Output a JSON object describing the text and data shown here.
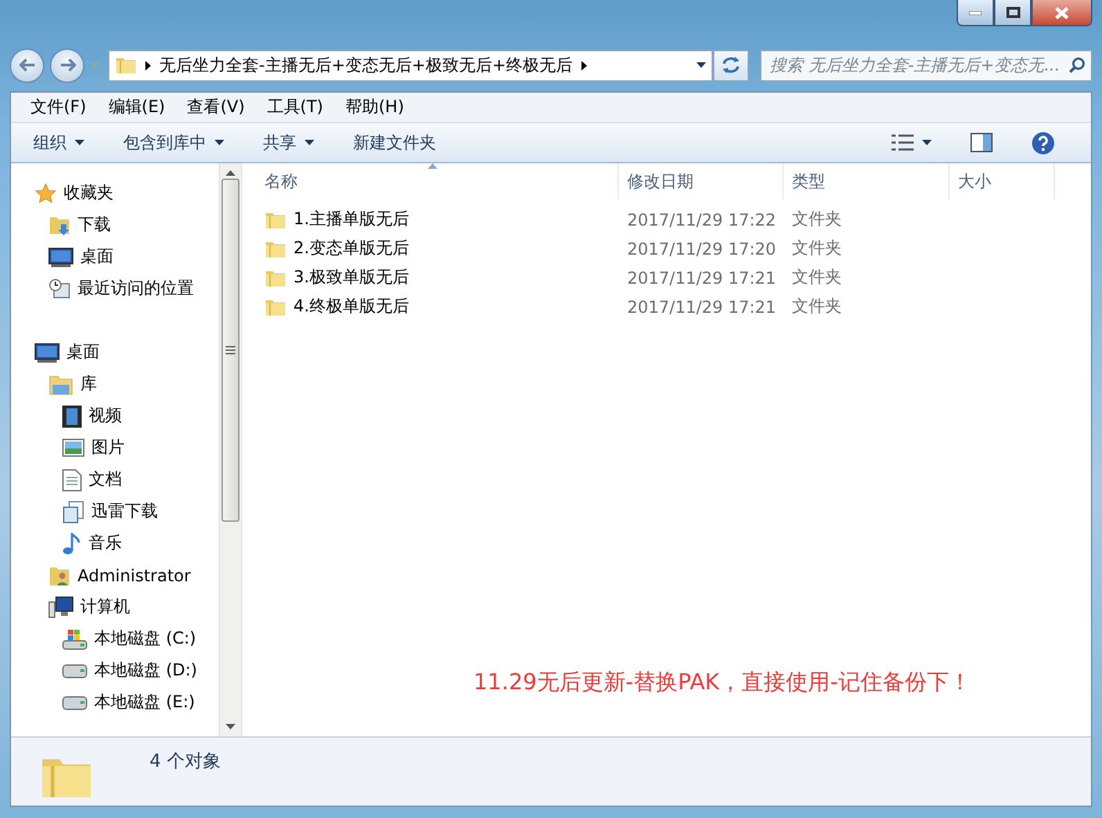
{
  "address": {
    "path": "无后坐力全套-主播无后+变态无后+极致无后+终极无后",
    "search_placeholder": "搜索 无后坐力全套-主播无后+变态无..."
  },
  "menu": [
    "文件(F)",
    "编辑(E)",
    "查看(V)",
    "工具(T)",
    "帮助(H)"
  ],
  "toolbar": [
    {
      "label": "组织",
      "dropdown": true
    },
    {
      "label": "包含到库中",
      "dropdown": true
    },
    {
      "label": "共享",
      "dropdown": true
    },
    {
      "label": "新建文件夹",
      "dropdown": false
    }
  ],
  "sidebar": {
    "items": [
      {
        "label": "收藏夹",
        "kind": "star",
        "children": [
          {
            "label": "下载",
            "kind": "download"
          },
          {
            "label": "桌面",
            "kind": "desktop"
          },
          {
            "label": "最近访问的位置",
            "kind": "recent"
          }
        ]
      },
      {
        "label": "桌面",
        "kind": "desktop",
        "children": [
          {
            "label": "库",
            "kind": "library",
            "children": [
              {
                "label": "视频",
                "kind": "video"
              },
              {
                "label": "图片",
                "kind": "picture"
              },
              {
                "label": "文档",
                "kind": "document"
              },
              {
                "label": "迅雷下载",
                "kind": "thunder"
              },
              {
                "label": "音乐",
                "kind": "music"
              }
            ]
          },
          {
            "label": "Administrator",
            "kind": "user"
          },
          {
            "label": "计算机",
            "kind": "computer",
            "children": [
              {
                "label": "本地磁盘 (C:)",
                "kind": "drive-windows"
              },
              {
                "label": "本地磁盘 (D:)",
                "kind": "drive"
              },
              {
                "label": "本地磁盘 (E:)",
                "kind": "drive"
              }
            ]
          }
        ]
      }
    ]
  },
  "table": {
    "columns": [
      "名称",
      "修改日期",
      "类型",
      "大小"
    ],
    "rows": [
      {
        "name": "1.主播单版无后",
        "date": "2017/11/29 17:22",
        "type": "文件夹"
      },
      {
        "name": "2.变态单版无后",
        "date": "2017/11/29 17:20",
        "type": "文件夹"
      },
      {
        "name": "3.极致单版无后",
        "date": "2017/11/29 17:21",
        "type": "文件夹"
      },
      {
        "name": "4.终极单版无后",
        "date": "2017/11/29 17:21",
        "type": "文件夹"
      }
    ]
  },
  "note": "11.29无后更新-替换PAK，直接使用-记住备份下！",
  "status_bar": {
    "count": "4 个对象"
  }
}
